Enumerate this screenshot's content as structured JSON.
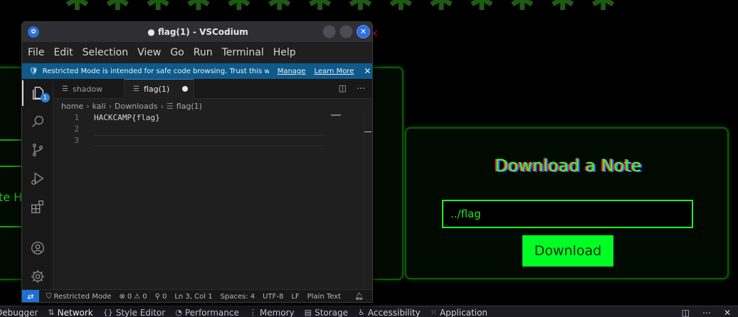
{
  "colors": {
    "neon_green": "#00ff22",
    "panel_border": "#0e5a08",
    "vscode_blue": "#0e5a8a",
    "accent_blue": "#2e6fe0"
  },
  "background_page": {
    "heading": "✱ ✱ ✱ ✱ ✱   ✱ ✱ ✱ ✱ ✱ ✱ ✱   ✱ ✱",
    "left_partial_text": "te H",
    "download_panel": {
      "title": "Download a Note",
      "input_value": "../flag",
      "button_label": "Download"
    }
  },
  "devtools": {
    "tabs": [
      {
        "icon": "",
        "label": "Debugger"
      },
      {
        "icon": "⇅",
        "label": "Network"
      },
      {
        "icon": "{}",
        "label": "Style Editor"
      },
      {
        "icon": "◔",
        "label": "Performance"
      },
      {
        "icon": "⋮",
        "label": "Memory"
      },
      {
        "icon": "▤",
        "label": "Storage"
      },
      {
        "icon": "♿",
        "label": "Accessibility"
      },
      {
        "icon": "⁙",
        "label": "Application"
      }
    ]
  },
  "window": {
    "title": "● flag(1) - VSCodium",
    "buttons": {
      "minimize": "",
      "maximize": "",
      "close": "✕"
    }
  },
  "menu": [
    "File",
    "Edit",
    "Selection",
    "View",
    "Go",
    "Run",
    "Terminal",
    "Help"
  ],
  "banner": {
    "message": "Restricted Mode is intended for safe code browsing. Trust this windo...",
    "manage": "Manage",
    "learn_more": "Learn More",
    "close": "✕"
  },
  "activity_bar": {
    "explorer_badge": "1",
    "icons": [
      "explorer-icon",
      "search-icon",
      "source-control-icon",
      "run-debug-icon",
      "extensions-icon",
      "account-icon",
      "settings-gear-icon"
    ]
  },
  "tabs": [
    {
      "label": "shadow"
    },
    {
      "label": "flag(1)"
    }
  ],
  "breadcrumb": [
    "home",
    "kali",
    "Downloads",
    "flag(1)"
  ],
  "editor": {
    "line_numbers": [
      "1",
      "2",
      "3"
    ],
    "lines": [
      "HACKCAMP{flag}",
      "",
      ""
    ]
  },
  "statusbar": {
    "remote": "⇄",
    "restricted": "Restricted Mode",
    "errors": "0",
    "warnings": "0",
    "ports": "0",
    "cursor": "Ln 3, Col 1",
    "spaces": "Spaces: 4",
    "encoding": "UTF-8",
    "eol": "LF",
    "language": "Plain Text"
  }
}
